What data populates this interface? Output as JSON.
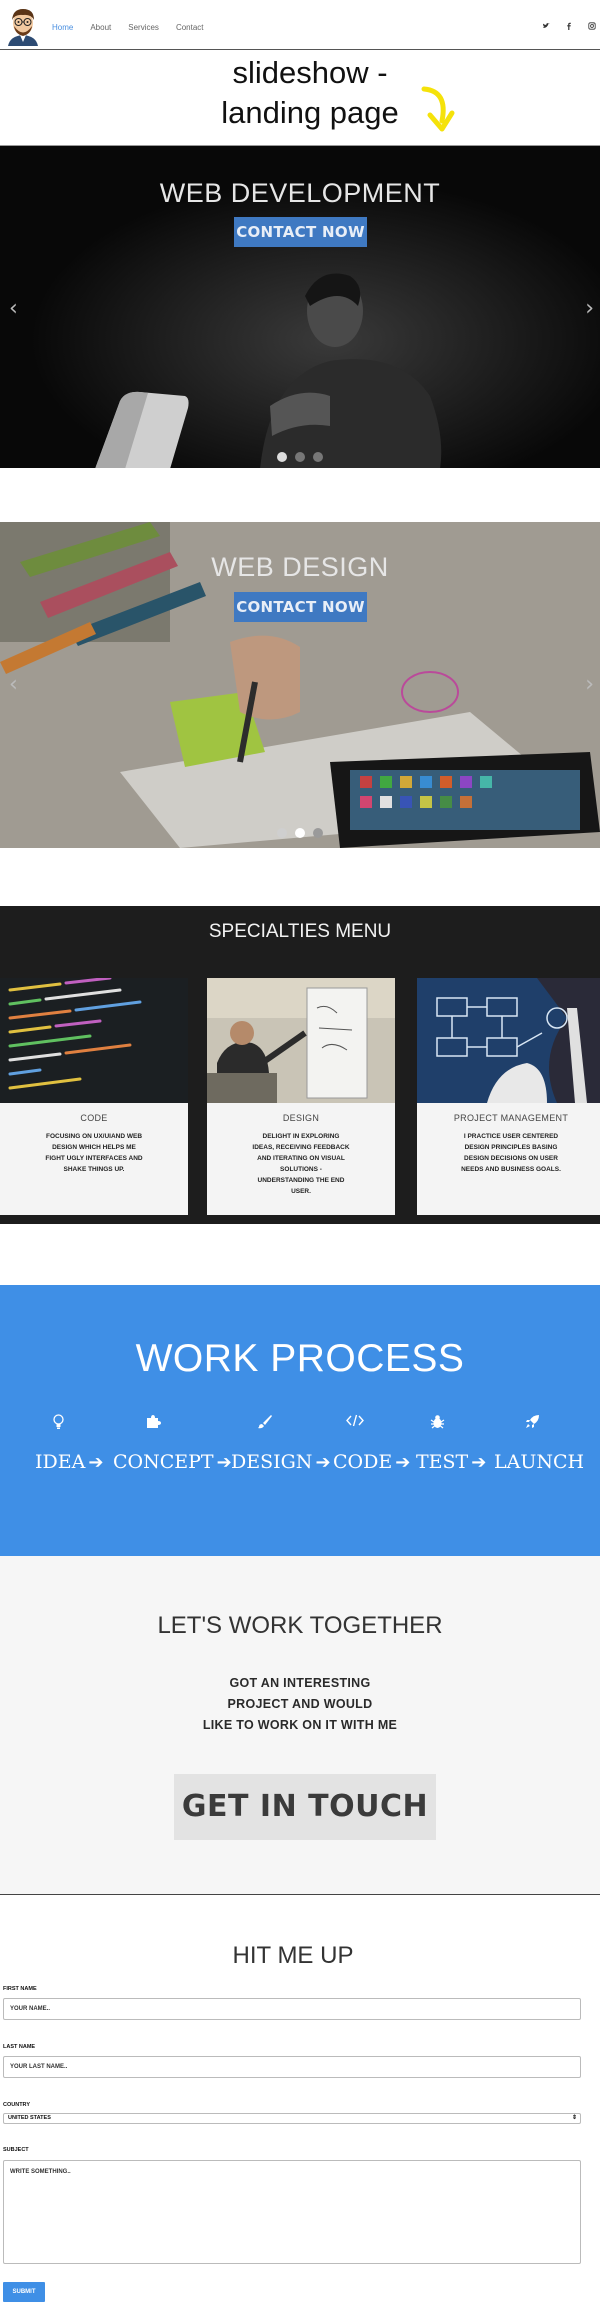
{
  "nav": {
    "links": [
      "Home",
      "About",
      "Services",
      "Contact"
    ],
    "active_index": 0,
    "social_icons": [
      "twitter-icon",
      "facebook-icon",
      "instagram-icon"
    ],
    "accent_color": "#4a8fe0"
  },
  "annotation": {
    "line1": "slideshow -",
    "line2": "landing page",
    "arrow_color": "#f5e20a"
  },
  "slides": [
    {
      "title": "WEB DEVELOPMENT",
      "cta": "CONTACT NOW",
      "active_dot": 0
    },
    {
      "title": "WEB DESIGN",
      "cta": "CONTACT NOW",
      "active_dot": 1
    }
  ],
  "specialties": {
    "title": "SPECIALTIES MENU",
    "cards": [
      {
        "title": "CODE",
        "desc": "FOCUSING ON UX/UIAND WEB DESIGN WHICH HELPS ME FIGHT UGLY INTERFACES AND SHAKE THINGS UP."
      },
      {
        "title": "DESIGN",
        "desc": "DELIGHT IN EXPLORING IDEAS, RECEIVING FEEDBACK AND ITERATING ON VISUAL SOLUTIONS - UNDERSTANDING THE END USER."
      },
      {
        "title": "PROJECT MANAGEMENT",
        "desc": "I PRACTICE USER CENTERED DESIGN PRINCIPLES BASING DESIGN DECISIONS ON USER NEEDS AND BUSINESS GOALS."
      }
    ]
  },
  "work_process": {
    "title": "WORK PROCESS",
    "steps": [
      {
        "label": "IDEA",
        "icon": "lightbulb-icon"
      },
      {
        "label": "CONCEPT",
        "icon": "puzzle-icon"
      },
      {
        "label": "DESIGN",
        "icon": "brush-icon"
      },
      {
        "label": "CODE",
        "icon": "code-icon"
      },
      {
        "label": "TEST",
        "icon": "bug-icon"
      },
      {
        "label": "LAUNCH",
        "icon": "rocket-icon"
      }
    ],
    "color": "#3f8fe6"
  },
  "work_together": {
    "title": "LET'S WORK TOGETHER",
    "line1": "GOT AN INTERESTING",
    "line2": "PROJECT AND WOULD",
    "line3": "LIKE TO WORK ON IT WITH ME",
    "button": "GET IN TOUCH"
  },
  "contact_form": {
    "title": "HIT ME UP",
    "first_name_label": "FIRST NAME",
    "first_name_placeholder": "YOUR NAME..",
    "last_name_label": "LAST NAME",
    "last_name_placeholder": "YOUR LAST NAME..",
    "country_label": "COUNTRY",
    "country_value": "UNITED STATES",
    "subject_label": "SUBJECT",
    "subject_placeholder": "WRITE SOMETHING..",
    "submit": "SUBMIT"
  }
}
